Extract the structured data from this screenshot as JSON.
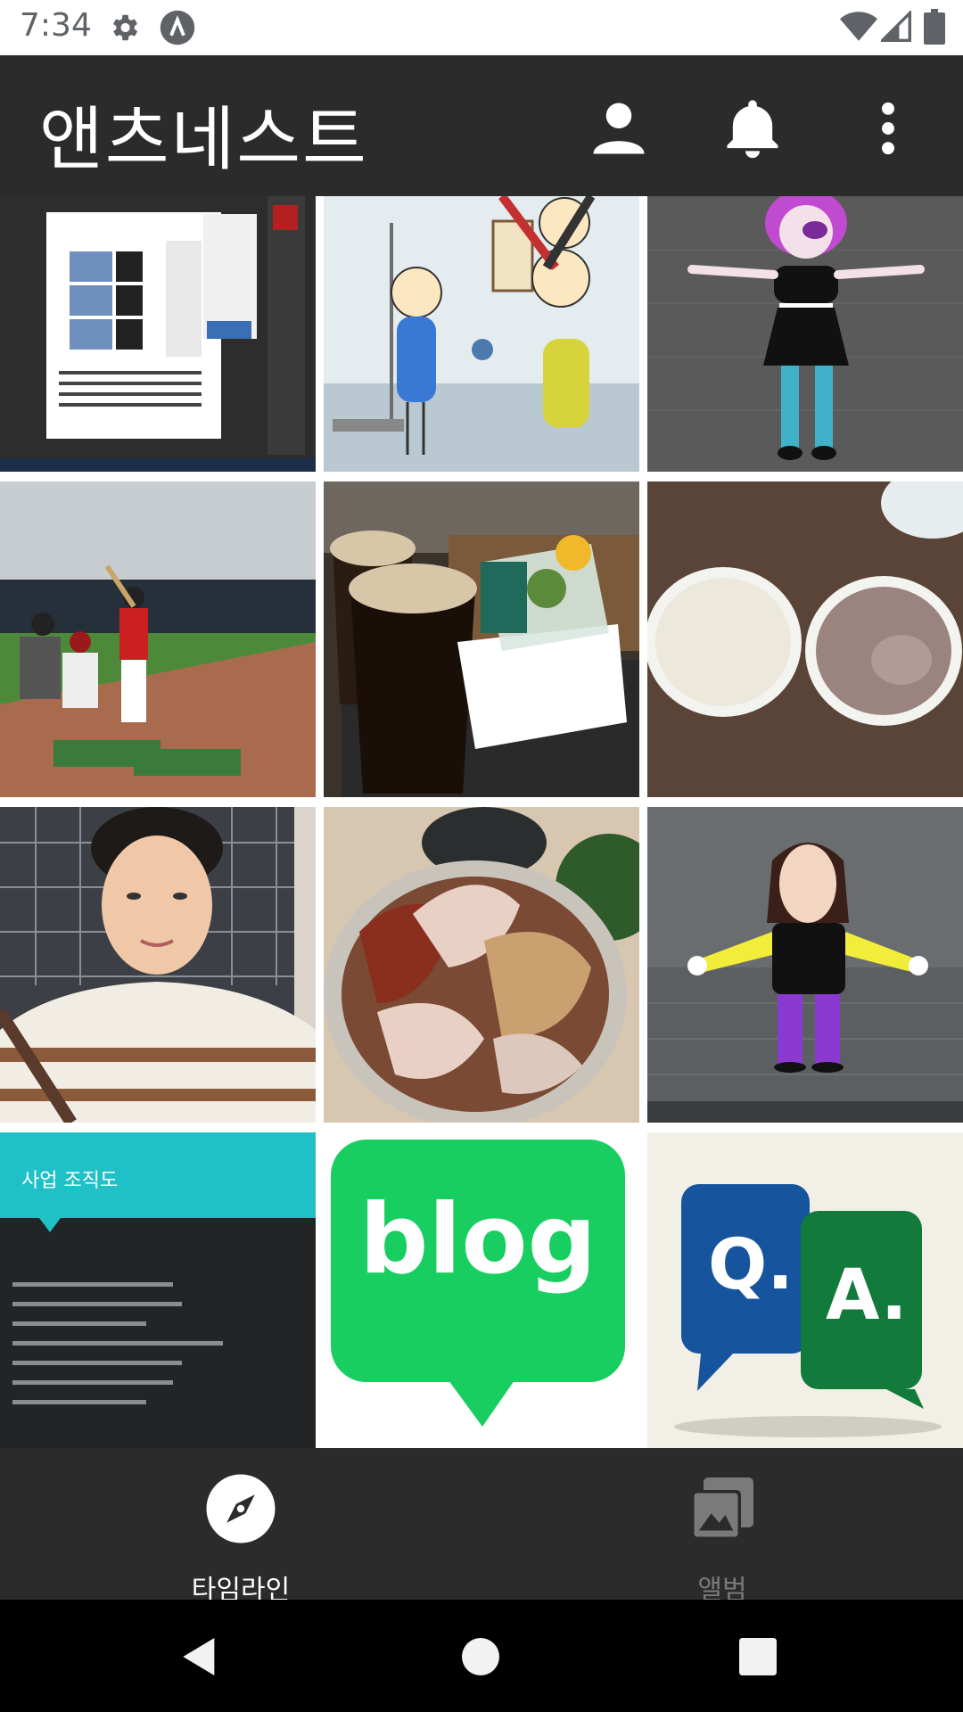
{
  "status_bar": {
    "time": "7:34",
    "icons": [
      "gear-icon",
      "app-notification-icon",
      "wifi-icon",
      "signal-icon",
      "battery-icon"
    ]
  },
  "app_bar": {
    "title": "앤츠네스트",
    "actions": [
      "profile-icon",
      "bell-icon",
      "more-vert-icon"
    ]
  },
  "photo_grid": {
    "tiles": [
      {
        "name": "photo-screenshot-editor"
      },
      {
        "name": "photo-cartoon-treadmill"
      },
      {
        "name": "photo-3d-character-purple-hair"
      },
      {
        "name": "photo-baseball-game"
      },
      {
        "name": "photo-iced-coffee-salad"
      },
      {
        "name": "photo-yogurt-cups"
      },
      {
        "name": "photo-selfie-man"
      },
      {
        "name": "photo-pork-dish"
      },
      {
        "name": "photo-3d-character-yellow-shirt"
      },
      {
        "name": "photo-org-chart-slide",
        "heading": "사업 조직도"
      },
      {
        "name": "photo-blog-logo",
        "text": "blog"
      },
      {
        "name": "photo-qa-logo",
        "q": "Q.",
        "a": "A."
      }
    ]
  },
  "bottom_nav": {
    "items": [
      {
        "label": "타임라인",
        "icon": "compass-icon",
        "active": true
      },
      {
        "label": "앨범",
        "icon": "album-icon",
        "active": false
      }
    ]
  },
  "system_nav": [
    "back-icon",
    "home-icon",
    "recents-icon"
  ],
  "colors": {
    "app_bar": "#2b2b2b",
    "bottom_nav": "#2b2b2b",
    "active": "#ffffff",
    "inactive": "#7a7a7a",
    "blog_green": "#19ce60"
  }
}
